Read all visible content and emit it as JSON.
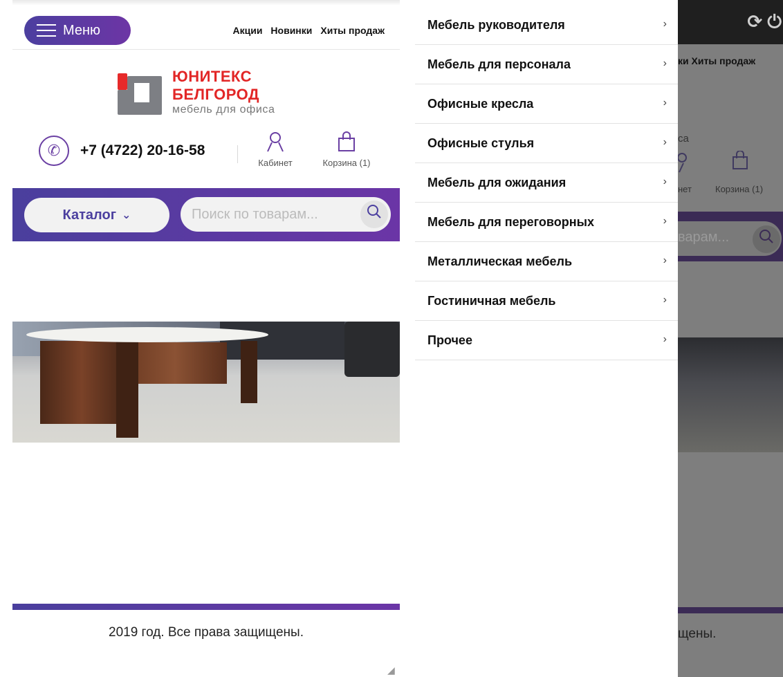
{
  "header": {
    "menu_label": "Меню",
    "links": [
      "Акции",
      "Новинки",
      "Хиты продаж"
    ]
  },
  "logo": {
    "name_line1": "ЮНИТЕКС",
    "name_line2": "БЕЛГОРОД",
    "tagline": "мебель для офиса"
  },
  "contacts": {
    "phone": "+7 (4722) 20-16-58",
    "cabinet_label": "Кабинет",
    "cart_label": "Корзина (1)"
  },
  "catalog_bar": {
    "catalog_label": "Каталог",
    "search_placeholder": "Поиск по товарам..."
  },
  "footer": {
    "copyright": "2019 год. Все права защищены."
  },
  "dropdown": {
    "items": [
      "Мебель руководителя",
      "Мебель для персонала",
      "Офисные кресла",
      "Офисные стулья",
      "Мебель для ожидания",
      "Мебель для переговорных",
      "Металлическая мебель",
      "Гостиничная мебель",
      "Прочее"
    ],
    "arrow": "›"
  },
  "right_panel": {
    "links_fragment": "ки  Хиты продаж",
    "tagline_fragment": "са",
    "cabinet_fragment": "нет",
    "cart_label": "Корзина (1)",
    "search_fragment": "варам...",
    "copyright_fragment": "щены."
  },
  "icons": {
    "phone": "phone-icon",
    "cabinet": "user-icon",
    "cart": "shopping-bag-icon",
    "search": "search-icon",
    "refresh": "refresh-icon",
    "power": "power-icon"
  },
  "colors": {
    "accent_start": "#4a3f9d",
    "accent_end": "#6b35a6",
    "logo_red": "#e22626"
  }
}
